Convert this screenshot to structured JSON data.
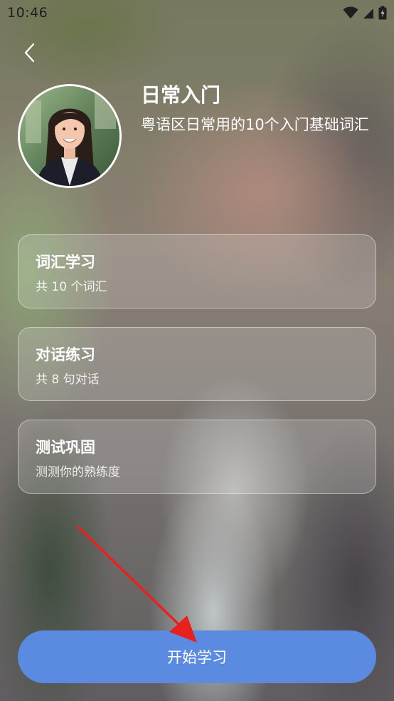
{
  "status_bar": {
    "time": "10:46",
    "icons": [
      "wifi-icon",
      "signal-icon",
      "battery-icon"
    ]
  },
  "header": {
    "back_icon": "chevron-left-icon",
    "avatar": "user-photo",
    "title": "日常入门",
    "description": "粤语区日常用的10个入门基础词汇"
  },
  "sections": [
    {
      "title": "词汇学习",
      "subtitle": "共 10 个词汇"
    },
    {
      "title": "对话练习",
      "subtitle": "共 8 句对话"
    },
    {
      "title": "测试巩固",
      "subtitle": "测测你的熟练度"
    }
  ],
  "start_button": {
    "label": "开始学习"
  },
  "colors": {
    "primary_button": "#5b8be0",
    "annotation_arrow": "#e8201e"
  }
}
